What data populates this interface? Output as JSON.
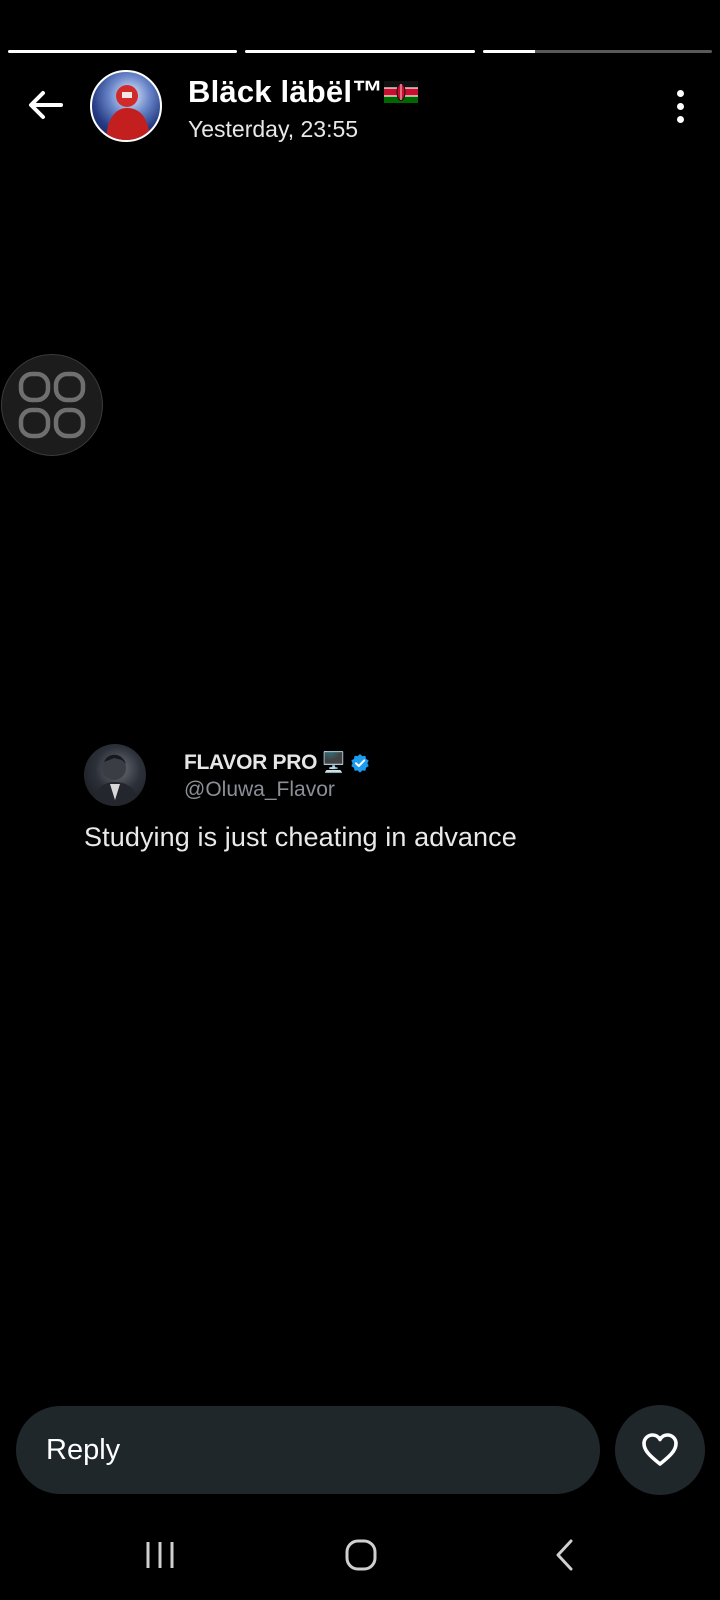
{
  "story": {
    "progress": [
      1.0,
      1.0,
      0.23
    ]
  },
  "header": {
    "user_name": "Bläck läbël™",
    "flag": "kenya-flag",
    "timestamp": "Yesterday, 23:55",
    "back_icon": "arrow-left-icon",
    "menu_icon": "more-vertical-icon"
  },
  "floating_widget": {
    "icon": "grid-icon"
  },
  "tweet": {
    "author_name": "FLAVOR PRO",
    "author_emoji": "🖥️",
    "verified_icon": "verified-badge-icon",
    "handle": "@Oluwa_Flavor",
    "text": "Studying is just cheating in advance"
  },
  "reply": {
    "placeholder": "Reply",
    "like_icon": "heart-icon"
  },
  "system_nav": {
    "recents_icon": "recent-apps-icon",
    "home_icon": "home-icon",
    "back_icon": "nav-back-icon"
  },
  "colors": {
    "background": "#000000",
    "surface": "#20272b",
    "verified": "#1d9bf0"
  }
}
